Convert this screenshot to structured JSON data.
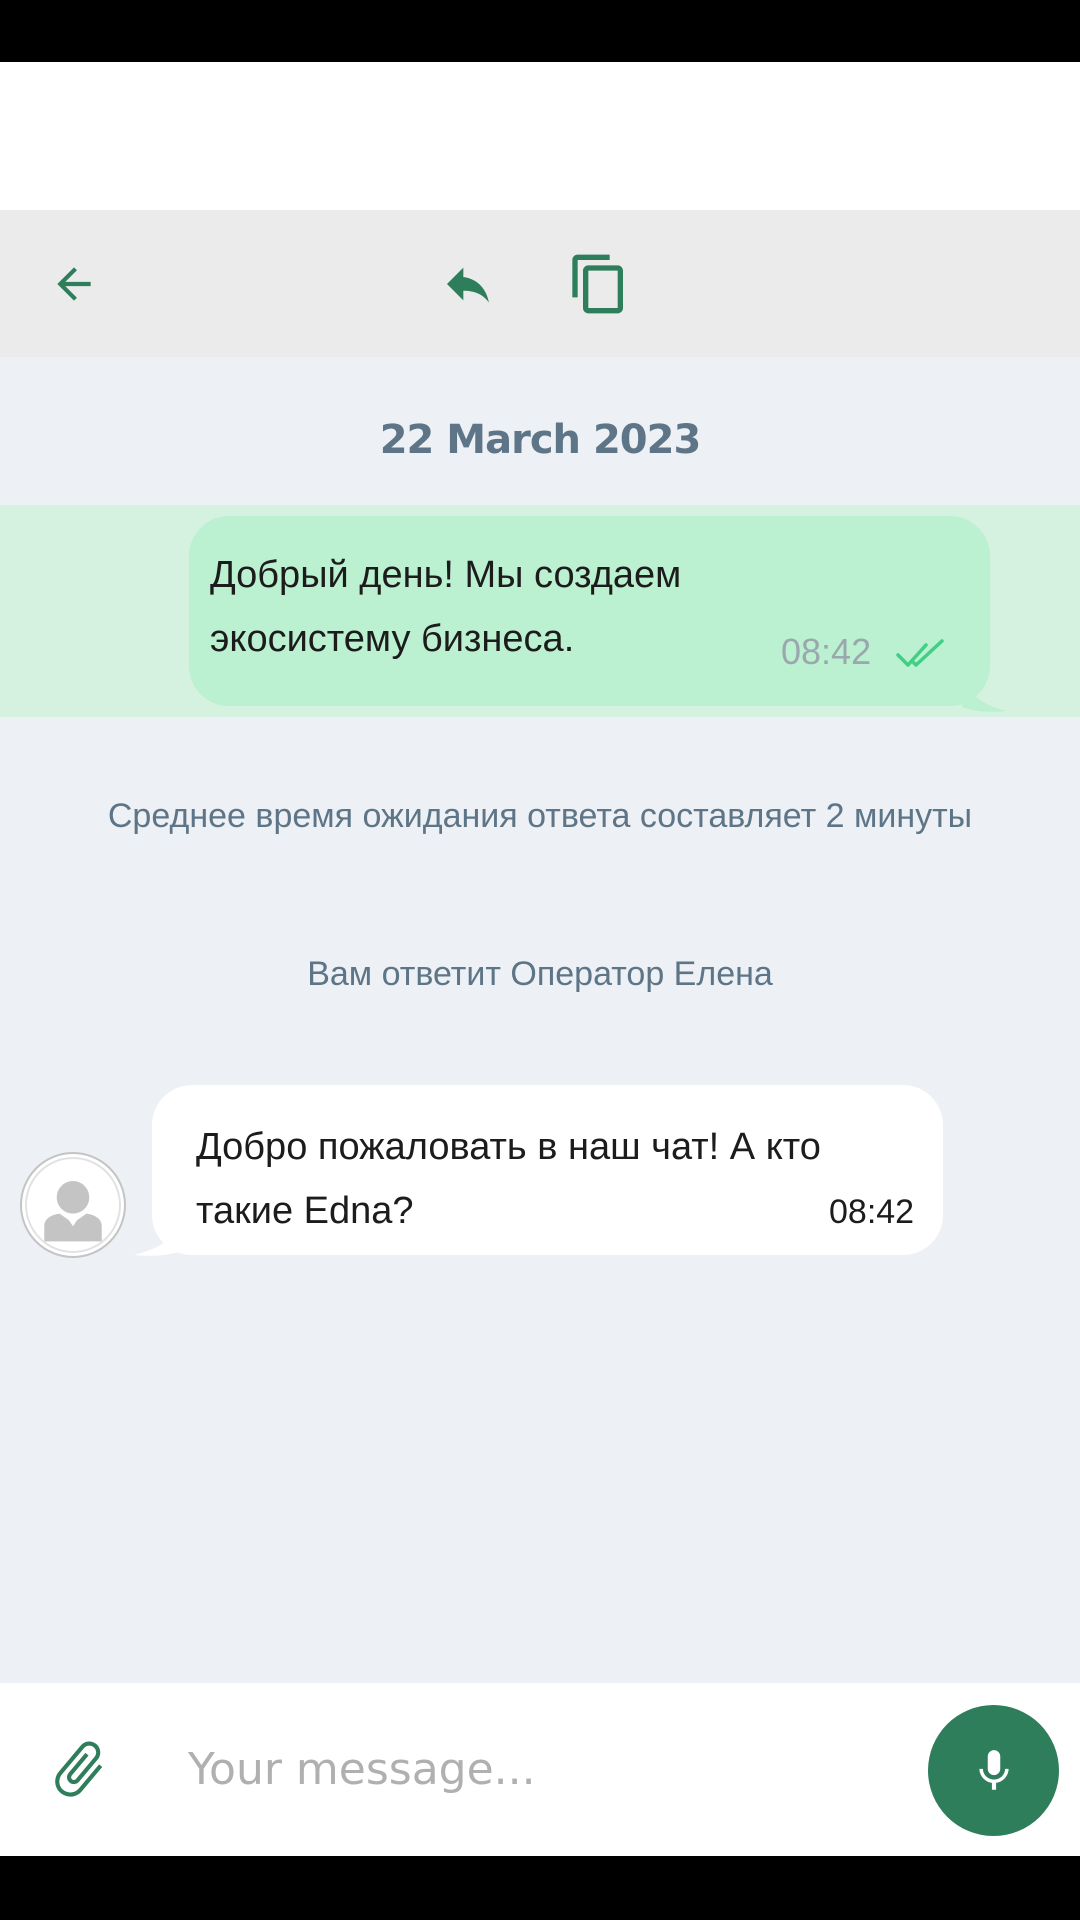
{
  "colors": {
    "accent": "#2e7d5b",
    "outgoing_bubble": "#bbf0d1",
    "selected_row": "#d5f1e0",
    "chat_background": "#edf0f5",
    "toolbar_background": "#ebebeb",
    "system_text": "#5d7587"
  },
  "toolbar": {
    "back_icon": "arrow-left-icon",
    "reply_icon": "reply-icon",
    "copy_icon": "copy-icon"
  },
  "chat": {
    "date_separator": "22 March 2023",
    "outgoing_message": {
      "text": "Добрый день! Мы создаем экосистему бизнеса.",
      "time": "08:42",
      "status_icon": "double-check-icon"
    },
    "system_messages": {
      "wait_time": "Среднее время ожидания ответа составляет 2 минуты",
      "operator": "Вам ответит Оператор Елена"
    },
    "incoming_message": {
      "text": "Добро пожаловать в наш чат! А кто такие Edna?",
      "time": "08:42",
      "avatar_icon": "person-avatar-icon"
    }
  },
  "composer": {
    "placeholder": "Your message...",
    "value": "",
    "attach_icon": "paperclip-icon",
    "mic_icon": "microphone-icon"
  }
}
